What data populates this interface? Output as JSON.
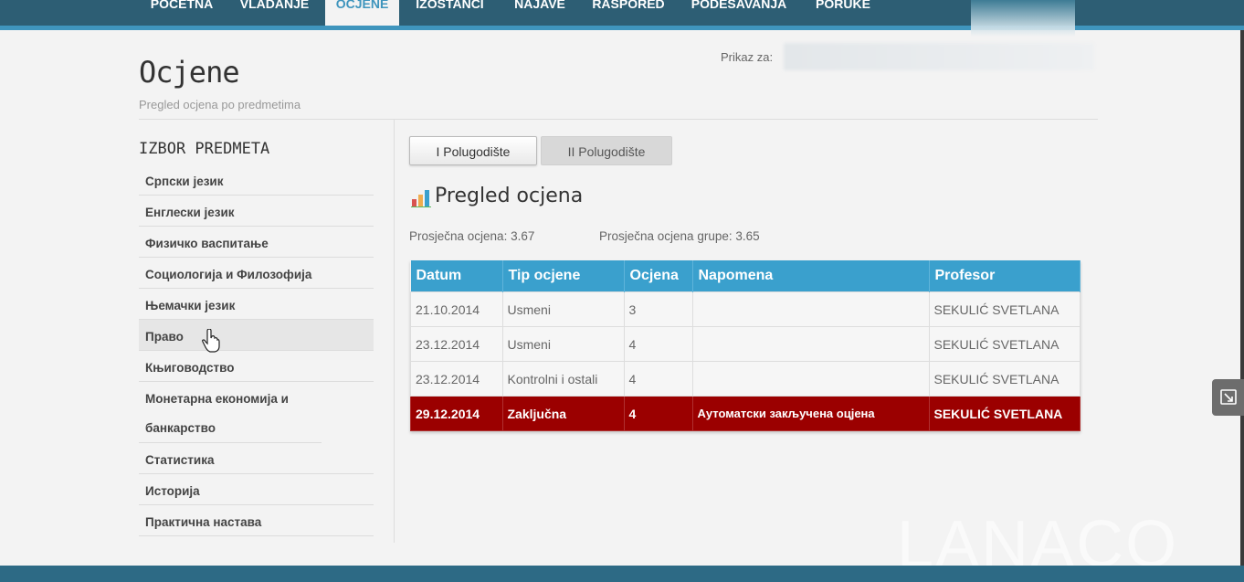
{
  "nav": {
    "items": [
      {
        "label": "POČETNA",
        "active": false
      },
      {
        "label": "VLADANJE",
        "active": false
      },
      {
        "label": "OCJENE",
        "active": true
      },
      {
        "label": "IZOSTANCI",
        "active": false
      },
      {
        "label": "NAJAVE",
        "active": false
      },
      {
        "label": "RASPORED",
        "active": false
      },
      {
        "label": "PODEŠAVANJA",
        "active": false
      },
      {
        "label": "PORUKE",
        "active": false
      }
    ]
  },
  "header": {
    "title": "Ocjene",
    "subtitle": "Pregled ocjena po predmetima",
    "prikaz_label": "Prikaz za:"
  },
  "sidebar": {
    "title": "IZBOR PREDMETA",
    "items": [
      {
        "label": "Српски језик"
      },
      {
        "label": "Енглески језик"
      },
      {
        "label": "Физичко васпитање"
      },
      {
        "label": "Социологија и Филозофија"
      },
      {
        "label": "Њемачки језик"
      },
      {
        "label": "Право"
      },
      {
        "label": "Књиговодство"
      },
      {
        "label": "Монетарна економија и банкарство"
      },
      {
        "label": "Статистика"
      },
      {
        "label": "Историја"
      },
      {
        "label": "Практична настава"
      }
    ]
  },
  "tabs": {
    "first": "I Polugodište",
    "second": "II Polugodište"
  },
  "overview": {
    "title": "Pregled ocjena",
    "avg": "Prosječna ocjena: 3.67",
    "group_avg": "Prosječna ocjena grupe: 3.65"
  },
  "table": {
    "headers": [
      "Datum",
      "Tip ocjene",
      "Ocjena",
      "Napomena",
      "Profesor"
    ],
    "rows": [
      {
        "datum": "21.10.2014",
        "tip": "Usmeni",
        "ocjena": "3",
        "napomena": "",
        "profesor": "SEKULIĆ SVETLANA"
      },
      {
        "datum": "23.12.2014",
        "tip": "Usmeni",
        "ocjena": "4",
        "napomena": "",
        "profesor": "SEKULIĆ SVETLANA"
      },
      {
        "datum": "23.12.2014",
        "tip": "Kontrolni i ostali",
        "ocjena": "4",
        "napomena": "",
        "profesor": "SEKULIĆ SVETLANA"
      },
      {
        "datum": "29.12.2014",
        "tip": "Zaključna",
        "ocjena": "4",
        "napomena": "Аутоматски закључена оцјена",
        "profesor": "SEKULIĆ SVETLANA"
      }
    ]
  },
  "watermark": "LANACO",
  "colors": {
    "nav_bg": "#2d5e74",
    "accent": "#3aa0cd",
    "final_row": "#9b0000"
  }
}
